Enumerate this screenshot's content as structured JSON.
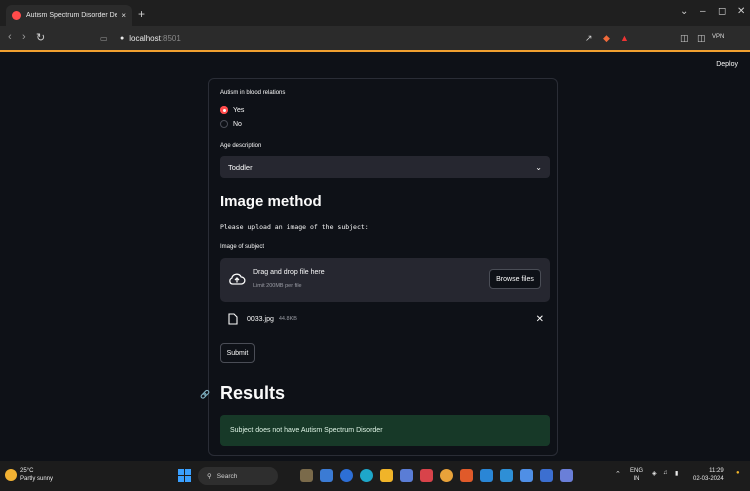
{
  "browser": {
    "tab_title": "Autism Spectrum Disorder Dete",
    "tab_close": "×",
    "new_tab": "+",
    "url_host": "localhost",
    "url_port": ":8501",
    "window_controls": [
      "⌄",
      "–",
      "◻",
      "✕"
    ],
    "vpn_label": "VPN"
  },
  "page": {
    "deploy_label": "Deploy",
    "blood_relations": {
      "label": "Autism in blood relations",
      "options": [
        "Yes",
        "No"
      ],
      "selected": "Yes"
    },
    "age": {
      "label": "Age description",
      "value": "Toddler"
    },
    "image_method": {
      "heading": "Image method",
      "instruction": "Please upload an image of the subject:",
      "uploader_label": "Image of subject",
      "drop_text": "Drag and drop file here",
      "limit_text": "Limit 200MB per file",
      "browse_label": "Browse files",
      "file_name": "0033.jpg",
      "file_size": "44.8KB"
    },
    "submit_label": "Submit",
    "results": {
      "heading": "Results",
      "message": "Subject does not have Autism Spectrum Disorder"
    }
  },
  "taskbar": {
    "temperature": "25°C",
    "weather": "Partly sunny",
    "search_label": "Search",
    "lang_line1": "ENG",
    "lang_line2": "IN",
    "time": "11:29",
    "date": "02-03-2024"
  },
  "colors": {
    "accent": "#ff4b4b",
    "background": "#0e1117",
    "success_bg": "#173928"
  }
}
